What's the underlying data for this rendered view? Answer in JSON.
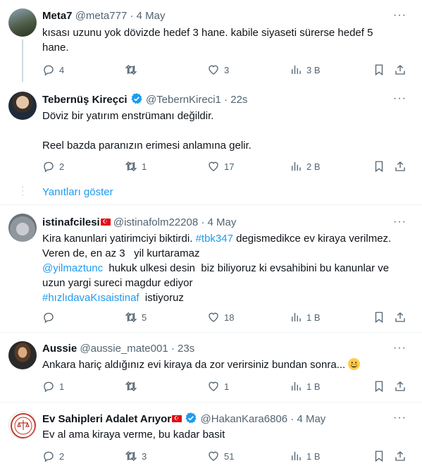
{
  "tweets": [
    {
      "name": "Meta7",
      "handle": "@meta777",
      "sep": "·",
      "time": "4 May",
      "lines": [
        "kısası uzunu yok dövizde hedef 3 hane. kabile siyaseti sürerse hedef 5",
        "hane."
      ],
      "replies": "4",
      "retweets": "",
      "likes": "3",
      "views": "3 B",
      "avatar_colors": [
        "#2f3a2c",
        "#6b7d5a"
      ]
    },
    {
      "name": "Tebernüş Kireçci",
      "handle": "@TebernKireci1",
      "sep": "·",
      "time": "22s",
      "line1": "Döviz bir yatırım enstrümanı değildir.",
      "line2": "Reel bazda paranızın erimesi anlamına gelir.",
      "replies": "2",
      "retweets": "1",
      "likes": "17",
      "views": "2 B"
    },
    {
      "show_replies": "Yanıtları göster"
    },
    {
      "name": "istinafcilesi",
      "handle": "@istinafolm22208",
      "sep": "·",
      "time": "4 May",
      "l1a": "Kira kanunlari  yatirimciyi biktirdi. ",
      "l1b": "#tbk347",
      "l1c": " degismedikce ev kiraya verilmez.",
      "l2": "Veren de, en az 3   yil kurtaramaz",
      "l3a": "@yilmaztunc",
      "l3b": "  hukuk ulkesi desin  biz biliyoruz ki evsahibini bu kanunlar ve",
      "l4": "uzun yargi sureci magdur ediyor",
      "l5a": "#hızlıdavaKısaistinaf",
      "l5b": "  istiyoruz",
      "replies": "",
      "retweets": "5",
      "likes": "18",
      "views": "1 B"
    },
    {
      "name": "Aussie",
      "handle": "@aussie_mate001",
      "sep": "·",
      "time": "23s",
      "text": "Ankara hariç aldığınız evi kiraya da zor verirsiniz bundan sonra...",
      "replies": "1",
      "retweets": "",
      "likes": "1",
      "views": "1 B"
    },
    {
      "name": "Ev Sahipleri Adalet Arıyor",
      "handle": "@HakanKara6806",
      "sep": "·",
      "time": "4 May",
      "text": "Ev al ama kiraya verme, bu kadar basit",
      "replies": "2",
      "retweets": "3",
      "likes": "51",
      "views": "1 B"
    }
  ],
  "more_label": "···",
  "colors": {
    "link": "#1d9bf0",
    "muted": "#536471",
    "divider": "#eff3f4",
    "verified": "#1d9bf0"
  }
}
